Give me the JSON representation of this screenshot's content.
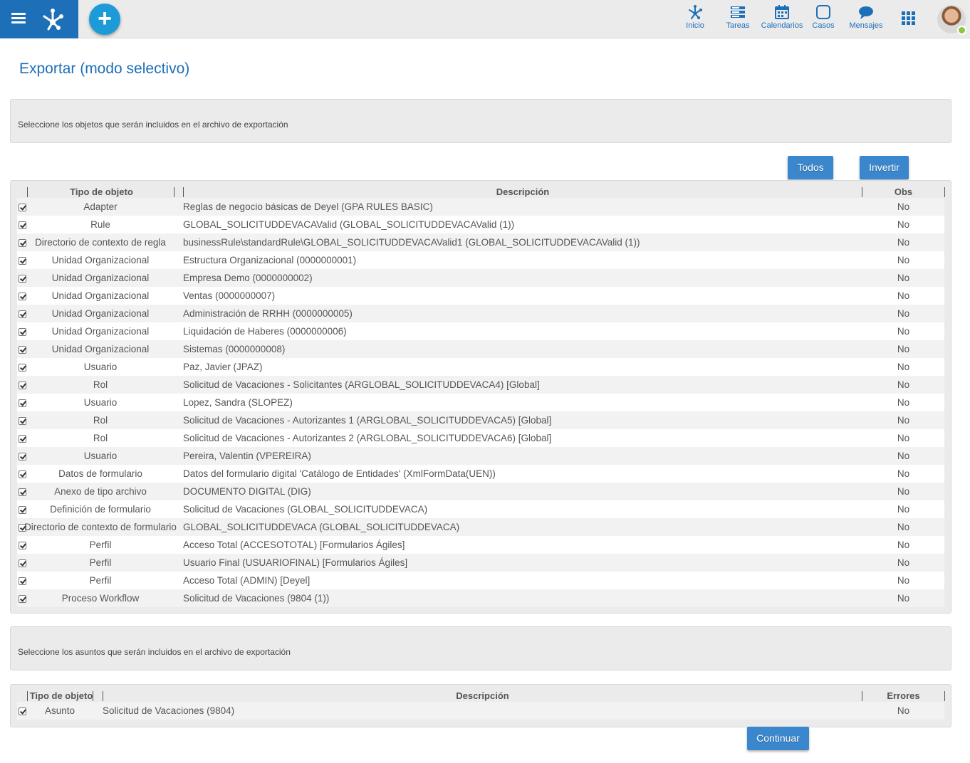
{
  "topbar": {
    "nav": [
      {
        "label": "Inicio",
        "icon": "process-icon"
      },
      {
        "label": "Tareas",
        "icon": "tasks-icon"
      },
      {
        "label": "Calendarios",
        "icon": "calendar-icon"
      },
      {
        "label": "Casos",
        "icon": "cases-icon"
      },
      {
        "label": "Mensajes",
        "icon": "message-icon"
      }
    ],
    "add_label": "+",
    "accent": "#1d6fb8",
    "online_color": "#8dc63f"
  },
  "page": {
    "title": "Exportar (modo selectivo)"
  },
  "objects_panel": {
    "message": "Seleccione los objetos que serán incluidos en el archivo de exportación"
  },
  "buttons": {
    "todos": "Todos",
    "invertir": "Invertir",
    "continuar": "Continuar"
  },
  "objects_table": {
    "headers": {
      "type": "Tipo de objeto",
      "desc": "Descripción",
      "obs": "Obs"
    },
    "rows": [
      {
        "checked": true,
        "type": "Adapter",
        "desc": "Reglas de negocio básicas de Deyel (GPA RULES BASIC)",
        "obs": "No"
      },
      {
        "checked": true,
        "type": "Rule",
        "desc": "GLOBAL_SOLICITUDDEVACAValid (GLOBAL_SOLICITUDDEVACAValid (1))",
        "obs": "No"
      },
      {
        "checked": true,
        "type": "Directorio de contexto de regla",
        "desc": "businessRule\\standardRule\\GLOBAL_SOLICITUDDEVACAValid1 (GLOBAL_SOLICITUDDEVACAValid (1))",
        "obs": "No"
      },
      {
        "checked": true,
        "type": "Unidad Organizacional",
        "desc": "Estructura Organizacional (0000000001)",
        "obs": "No"
      },
      {
        "checked": true,
        "type": "Unidad Organizacional",
        "desc": "Empresa Demo (0000000002)",
        "obs": "No"
      },
      {
        "checked": true,
        "type": "Unidad Organizacional",
        "desc": "Ventas (0000000007)",
        "obs": "No"
      },
      {
        "checked": true,
        "type": "Unidad Organizacional",
        "desc": "Administración de RRHH (0000000005)",
        "obs": "No"
      },
      {
        "checked": true,
        "type": "Unidad Organizacional",
        "desc": "Liquidación de Haberes (0000000006)",
        "obs": "No"
      },
      {
        "checked": true,
        "type": "Unidad Organizacional",
        "desc": "Sistemas (0000000008)",
        "obs": "No"
      },
      {
        "checked": true,
        "type": "Usuario",
        "desc": "Paz, Javier (JPAZ)",
        "obs": "No"
      },
      {
        "checked": true,
        "type": "Rol",
        "desc": "Solicitud de Vacaciones - Solicitantes (ARGLOBAL_SOLICITUDDEVACA4) [Global]",
        "obs": "No"
      },
      {
        "checked": true,
        "type": "Usuario",
        "desc": "Lopez, Sandra (SLOPEZ)",
        "obs": "No"
      },
      {
        "checked": true,
        "type": "Rol",
        "desc": "Solicitud de Vacaciones - Autorizantes 1 (ARGLOBAL_SOLICITUDDEVACA5) [Global]",
        "obs": "No"
      },
      {
        "checked": true,
        "type": "Rol",
        "desc": "Solicitud de Vacaciones - Autorizantes 2 (ARGLOBAL_SOLICITUDDEVACA6) [Global]",
        "obs": "No"
      },
      {
        "checked": true,
        "type": "Usuario",
        "desc": "Pereira, Valentin (VPEREIRA)",
        "obs": "No"
      },
      {
        "checked": true,
        "type": "Datos de formulario",
        "desc": "Datos del formulario digital 'Catálogo de Entidades' (XmlFormData(UEN))",
        "obs": "No"
      },
      {
        "checked": true,
        "type": "Anexo de tipo archivo",
        "desc": "DOCUMENTO DIGITAL (DIG)",
        "obs": "No"
      },
      {
        "checked": true,
        "type": "Definición de formulario",
        "desc": "Solicitud de Vacaciones (GLOBAL_SOLICITUDDEVACA)",
        "obs": "No"
      },
      {
        "checked": true,
        "type": "Directorio de contexto de formulario",
        "desc": "GLOBAL_SOLICITUDDEVACA (GLOBAL_SOLICITUDDEVACA)",
        "obs": "No"
      },
      {
        "checked": true,
        "type": "Perfil",
        "desc": "Acceso Total (ACCESOTOTAL) [Formularios Ágiles]",
        "obs": "No"
      },
      {
        "checked": true,
        "type": "Perfil",
        "desc": "Usuario Final (USUARIOFINAL) [Formularios Ágiles]",
        "obs": "No"
      },
      {
        "checked": true,
        "type": "Perfil",
        "desc": "Acceso Total (ADMIN) [Deyel]",
        "obs": "No"
      },
      {
        "checked": true,
        "type": "Proceso Workflow",
        "desc": "Solicitud de Vacaciones (9804 (1))",
        "obs": "No"
      }
    ]
  },
  "subjects_panel": {
    "message": "Seleccione los asuntos que serán incluidos en el archivo de exportación"
  },
  "subjects_table": {
    "headers": {
      "type": "Tipo de objeto",
      "desc": "Descripción",
      "errors": "Errores"
    },
    "rows": [
      {
        "checked": true,
        "type": "Asunto",
        "desc": "Solicitud de Vacaciones (9804)",
        "errors": "No"
      }
    ]
  }
}
